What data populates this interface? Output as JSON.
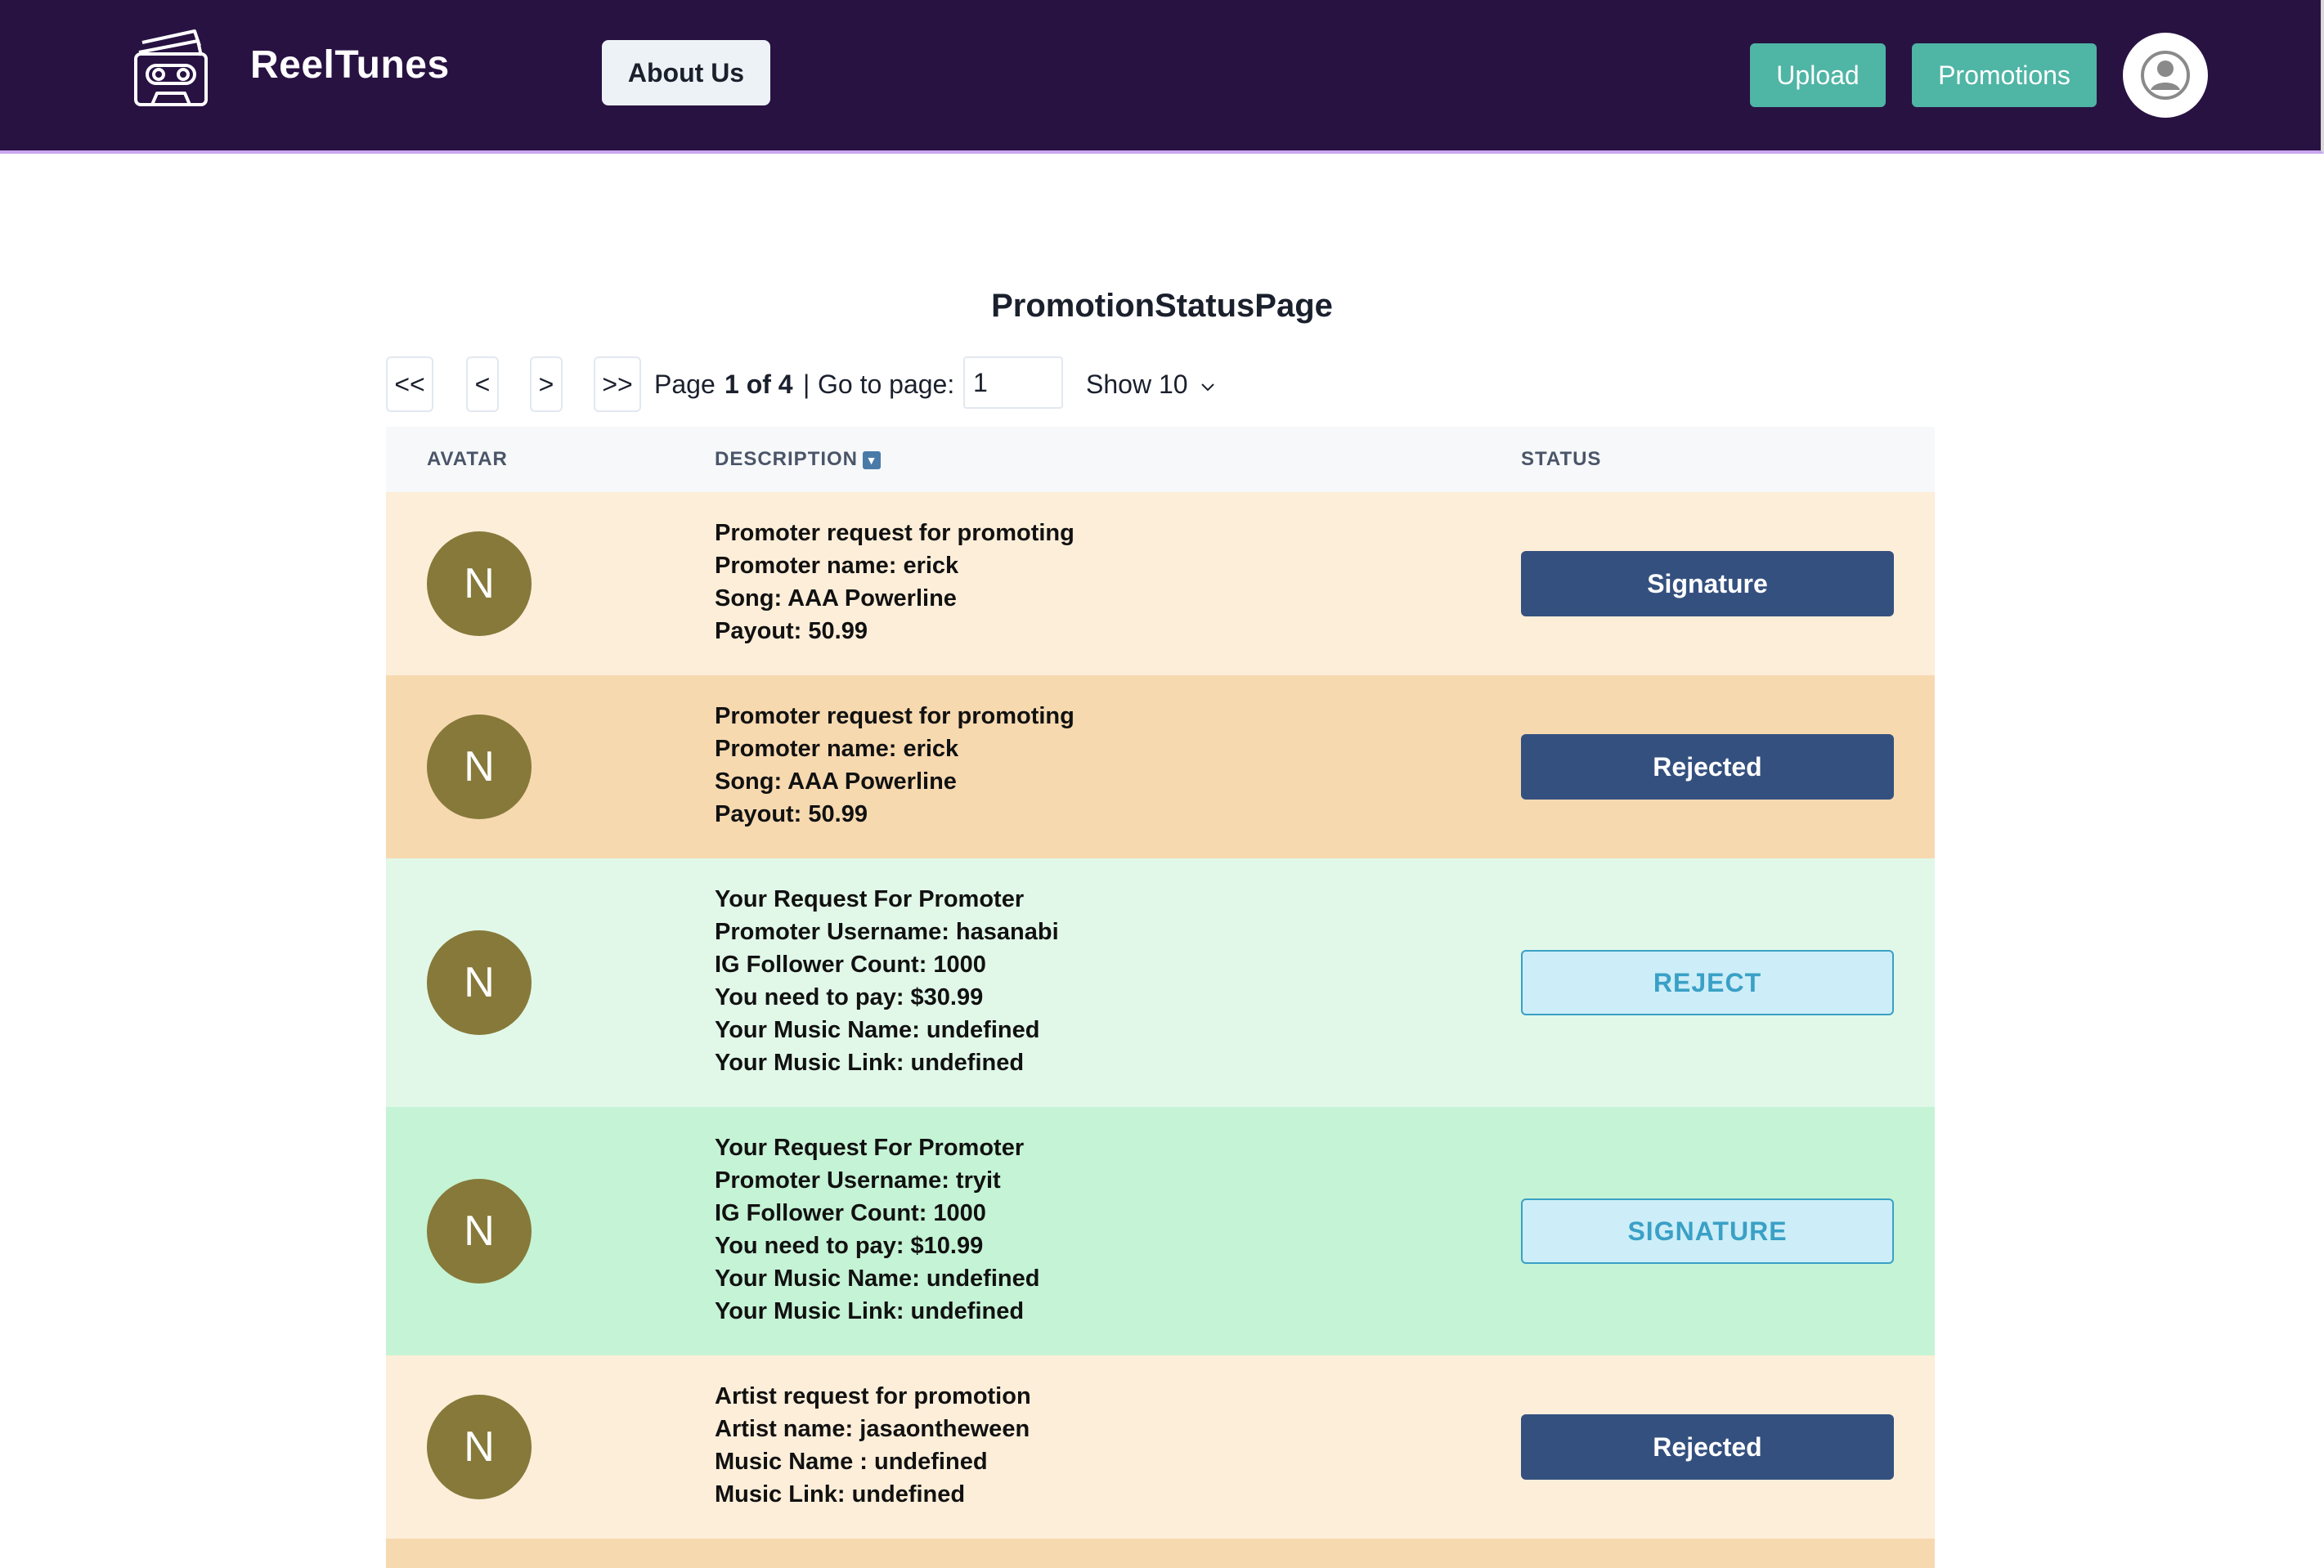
{
  "header": {
    "brand": "ReelTunes",
    "about_label": "About Us",
    "upload_label": "Upload",
    "promotions_label": "Promotions"
  },
  "page": {
    "title": "PromotionStatusPage"
  },
  "pagination": {
    "first": "<<",
    "prev": "<",
    "next": ">",
    "last": ">>",
    "page_word": "Page",
    "current_of_total": "1 of 4",
    "separator": "|",
    "goto_label": "Go to page:",
    "goto_value": "1",
    "show_label": "Show 10"
  },
  "table": {
    "columns": {
      "avatar": "AVATAR",
      "description": "DESCRIPTION",
      "status": "STATUS"
    },
    "rows": [
      {
        "avatar": "N",
        "lines": [
          "Promoter request for promoting",
          "Promoter name: erick",
          "Song: AAA Powerline",
          "Payout: 50.99"
        ],
        "status": "Signature"
      },
      {
        "avatar": "N",
        "lines": [
          "Promoter request for promoting",
          "Promoter name: erick",
          "Song: AAA Powerline",
          "Payout: 50.99"
        ],
        "status": "Rejected"
      },
      {
        "avatar": "N",
        "lines": [
          "Your Request For Promoter",
          "Promoter Username: hasanabi",
          "IG Follower Count: 1000",
          "You need to pay: $30.99",
          "Your Music Name: undefined",
          "Your Music Link: undefined"
        ],
        "status": "REJECT"
      },
      {
        "avatar": "N",
        "lines": [
          "Your Request For Promoter",
          "Promoter Username: tryit",
          "IG Follower Count: 1000",
          "You need to pay: $10.99",
          "Your Music Name: undefined",
          "Your Music Link: undefined"
        ],
        "status": "SIGNATURE"
      },
      {
        "avatar": "N",
        "lines": [
          "Artist request for promotion",
          "Artist name: jasaontheween",
          "Music Name : undefined",
          "Music Link: undefined"
        ],
        "status": "Rejected"
      }
    ]
  },
  "colors": {
    "navbar": "#281242",
    "accent": "#4fb5a5",
    "row_peach_light": "#fdeed9",
    "row_peach": "#f7d9b0",
    "row_green_light": "#e1f8e9",
    "row_green": "#c5f3d5",
    "status_solid": "#34507f",
    "status_outline_bg": "#cdeef8",
    "avatar": "#86793a"
  }
}
